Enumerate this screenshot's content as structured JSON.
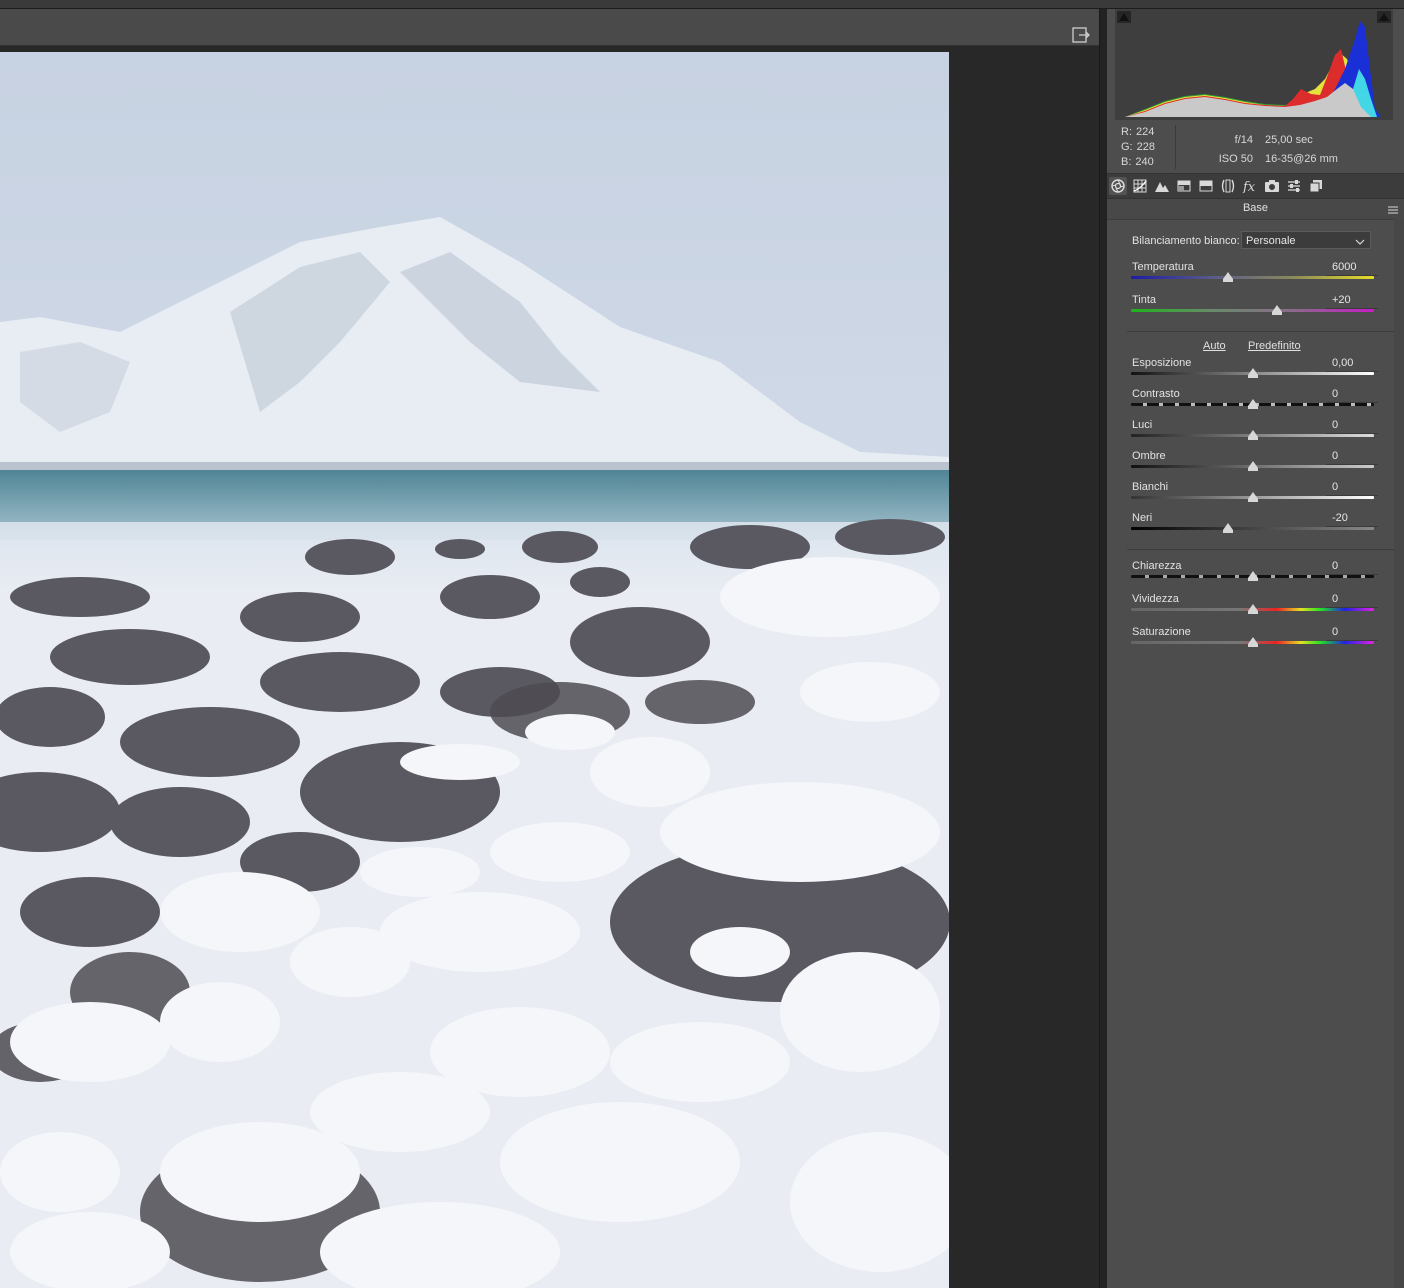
{
  "histogram": {
    "rgb_readout": [
      {
        "channel": "R:",
        "value": "224"
      },
      {
        "channel": "G:",
        "value": "228"
      },
      {
        "channel": "B:",
        "value": "240"
      }
    ],
    "exif": {
      "aperture": "f/14",
      "shutter": "25,00 sec",
      "iso": "ISO 50",
      "lens": "16-35@26 mm"
    }
  },
  "panel_tabs": [
    {
      "icon": "aperture-icon",
      "active": true
    },
    {
      "icon": "tone-curve-grid-icon",
      "active": false
    },
    {
      "icon": "detail-mountain-icon",
      "active": false
    },
    {
      "icon": "hsl-grayscale-icon",
      "active": false
    },
    {
      "icon": "split-toning-icon",
      "active": false
    },
    {
      "icon": "lens-corrections-icon",
      "active": false
    },
    {
      "icon": "effects-fx-icon",
      "active": false
    },
    {
      "icon": "camera-calibration-icon",
      "active": false
    },
    {
      "icon": "presets-sliders-icon",
      "active": false
    },
    {
      "icon": "snapshots-icon",
      "active": false
    }
  ],
  "section_title": "Base",
  "white_balance": {
    "label": "Bilanciamento bianco:",
    "selected": "Personale"
  },
  "buttons": {
    "auto": "Auto",
    "default": "Predefinito"
  },
  "sliders": {
    "temperature": {
      "label": "Temperatura",
      "value": "6000",
      "fraction": 0.4
    },
    "tint": {
      "label": "Tinta",
      "value": "+20",
      "fraction": 0.6
    },
    "exposure": {
      "label": "Esposizione",
      "value": "0,00",
      "fraction": 0.5
    },
    "contrast": {
      "label": "Contrasto",
      "value": "0",
      "fraction": 0.5
    },
    "highlights": {
      "label": "Luci",
      "value": "0",
      "fraction": 0.5
    },
    "shadows": {
      "label": "Ombre",
      "value": "0",
      "fraction": 0.5
    },
    "whites": {
      "label": "Bianchi",
      "value": "0",
      "fraction": 0.5
    },
    "blacks": {
      "label": "Neri",
      "value": "-20",
      "fraction": 0.4
    },
    "clarity": {
      "label": "Chiarezza",
      "value": "0",
      "fraction": 0.5
    },
    "vibrance": {
      "label": "Vividezza",
      "value": "0",
      "fraction": 0.5
    },
    "saturation": {
      "label": "Saturazione",
      "value": "0",
      "fraction": 0.5
    }
  },
  "colors": {
    "panel_bg": "#4d4d4d",
    "canvas_bg": "#282828",
    "toolbar_bg": "#4a4a4a"
  }
}
